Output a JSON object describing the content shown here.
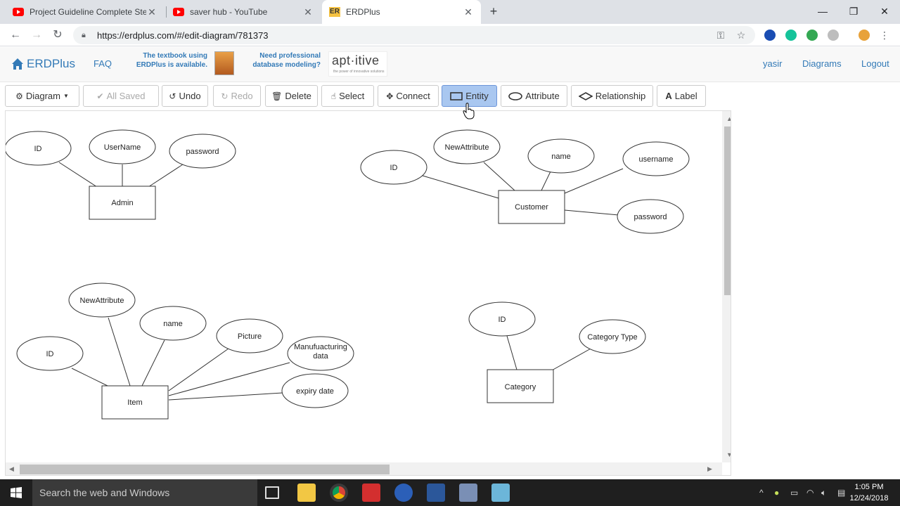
{
  "browser": {
    "tabs": [
      {
        "title": "Project Guideline Complete Step",
        "favicon": "youtube-icon"
      },
      {
        "title": "saver hub - YouTube",
        "favicon": "youtube-icon"
      },
      {
        "title": "ERDPlus",
        "favicon": "erdplus-icon",
        "favicon_text": "ER"
      }
    ],
    "url": "https://erdplus.com/#/edit-diagram/781373"
  },
  "header": {
    "brand": "ERDPlus",
    "faq": "FAQ",
    "promo_book": "The textbook using ERDPlus is available.",
    "promo_book_l1": "The textbook using",
    "promo_book_l2": "ERDPlus is available.",
    "promo_db_l1": "Need professional",
    "promo_db_l2": "database modeling?",
    "aptitive": "apt·itive",
    "aptitive_tag": "the power of innovative solutions",
    "user": "yasir",
    "diagrams": "Diagrams",
    "logout": "Logout"
  },
  "toolbar": {
    "diagram": "Diagram",
    "all_saved": "All Saved",
    "undo": "Undo",
    "redo": "Redo",
    "delete": "Delete",
    "select": "Select",
    "connect": "Connect",
    "entity": "Entity",
    "attribute": "Attribute",
    "relationship": "Relationship",
    "label": "Label"
  },
  "diagram": {
    "entities": [
      {
        "id": "admin",
        "name": "Admin",
        "attributes": [
          "ID",
          "UserName",
          "password"
        ]
      },
      {
        "id": "customer",
        "name": "Customer",
        "attributes": [
          "ID",
          "NewAttribute",
          "name",
          "username",
          "password"
        ]
      },
      {
        "id": "item",
        "name": "Item",
        "attributes": [
          "NewAttribute",
          "name",
          "ID",
          "Picture",
          "Manufuacturing data",
          "expiry date"
        ]
      },
      {
        "id": "category",
        "name": "Category",
        "attributes": [
          "ID",
          "Category Type"
        ]
      }
    ]
  },
  "taskbar": {
    "search": "Search the web and Windows",
    "time": "1:05 PM",
    "date": "12/24/2018"
  },
  "colors": {
    "brand_link": "#337ab7",
    "active_button": "#a9c7f0",
    "taskbar": "#1f1f1f"
  }
}
